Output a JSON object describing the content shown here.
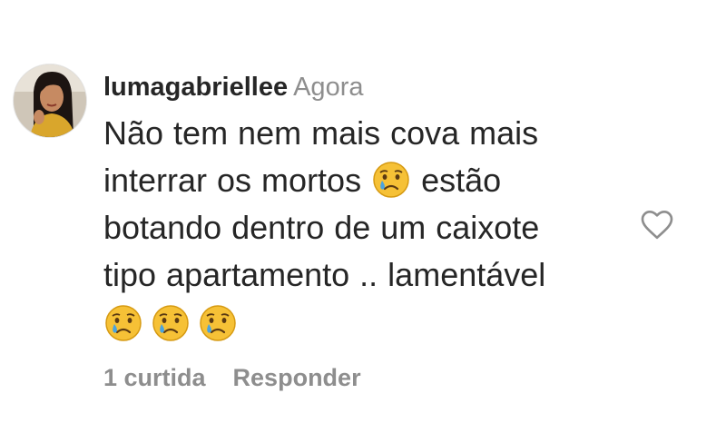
{
  "comment": {
    "username": "lumagabriellee",
    "timestamp": "Agora",
    "text_lines": [
      "Não tem nem mais cova mais",
      "interrar os mortos",
      "estão",
      "botando dentro de um caixote",
      "tipo apartamento .. lamentável"
    ],
    "emoji_name": "crying-face",
    "likes_label": "1 curtida",
    "reply_label": "Responder"
  },
  "icons": {
    "like": "heart-outline-icon",
    "emoji": "crying-face-icon"
  },
  "colors": {
    "text": "#262626",
    "secondary": "#8e8e8e",
    "emoji_face": "#f6c136",
    "emoji_tear": "#4aa3df",
    "heart_stroke": "#8e8e8e"
  }
}
